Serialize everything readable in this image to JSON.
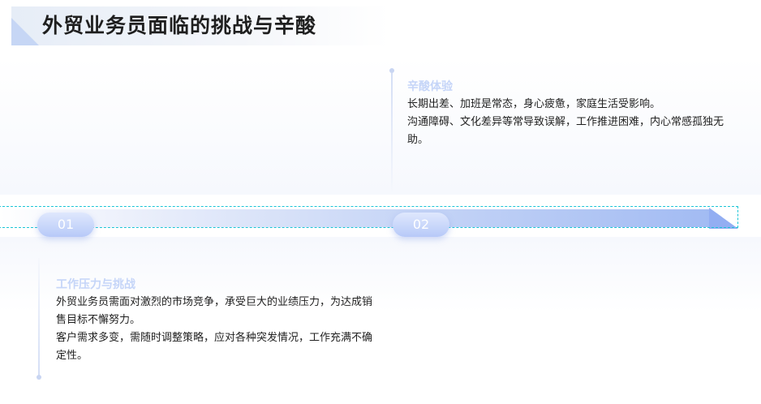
{
  "page": {
    "title": "外贸业务员面临的挑战与辛酸"
  },
  "timeline": {
    "items": [
      {
        "number": "01",
        "heading": "工作压力与挑战",
        "lines": [
          "外贸业务员需面对激烈的市场竞争，承受巨大的业绩压力，为达成销售目标不懈努力。",
          "客户需求多变，需随时调整策略，应对各种突发情况，工作充满不确定性。"
        ]
      },
      {
        "number": "02",
        "heading": "辛酸体验",
        "lines": [
          "长期出差、加班是常态，身心疲惫，家庭生活受影响。",
          "沟通障碍、文化差异等常导致误解，工作推进困难，内心常感孤独无助。"
        ]
      }
    ]
  },
  "colors": {
    "accent": "#c5d5f8",
    "bar_end": "#93aef2",
    "selection": "#1bc5d6",
    "text": "#1f1f1f"
  }
}
